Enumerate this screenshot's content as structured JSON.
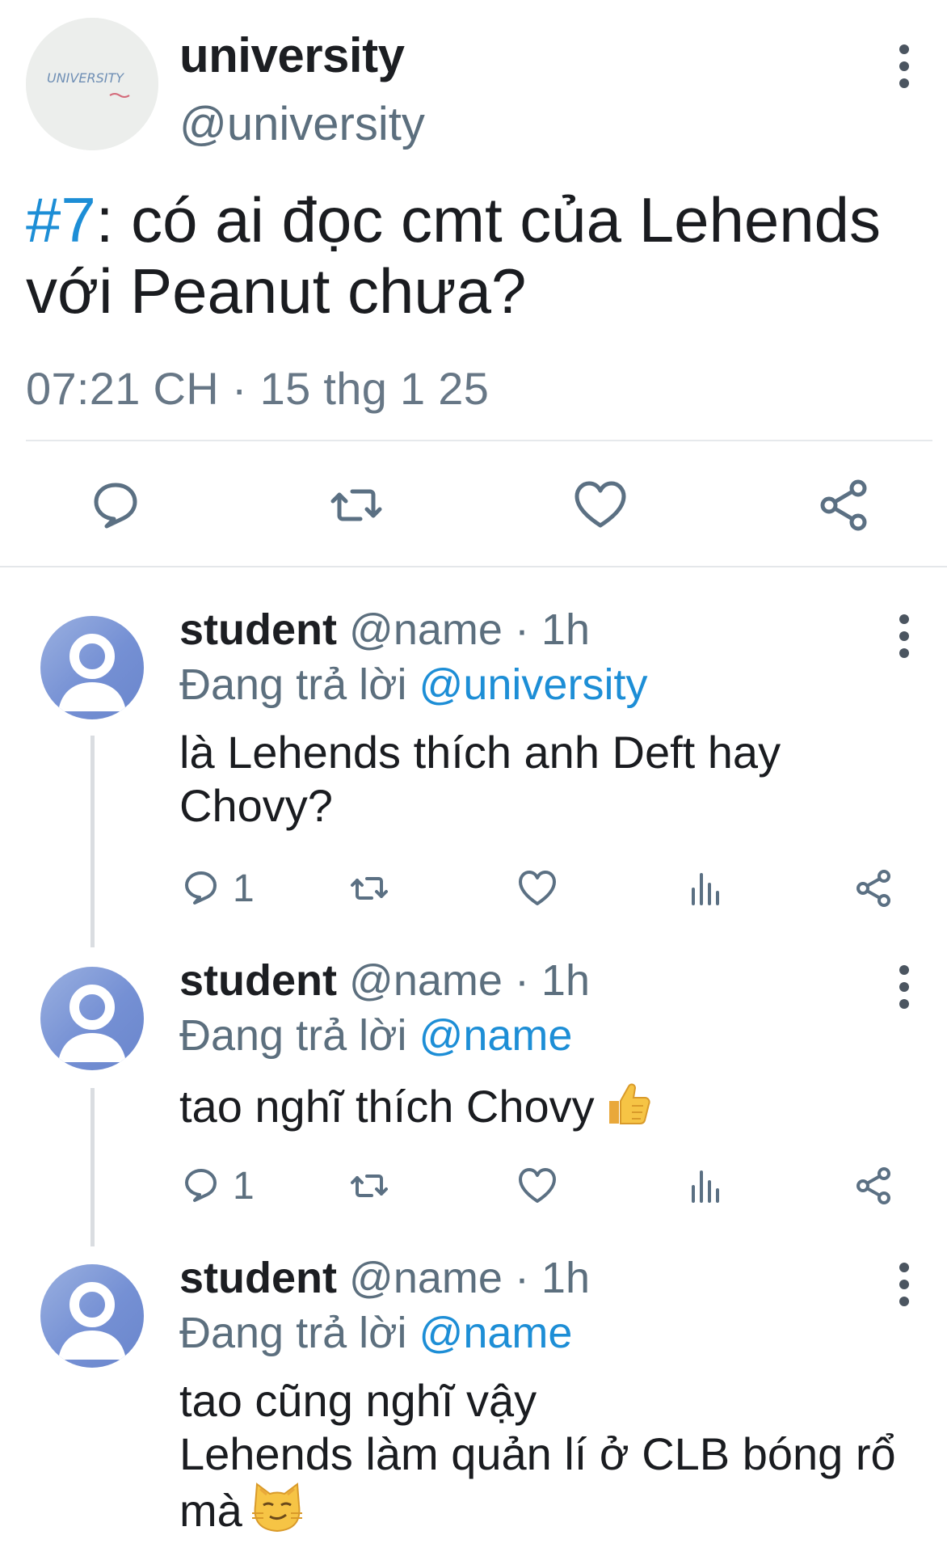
{
  "tweet": {
    "avatar_text": "UNIVERSITY",
    "name": "university",
    "handle": "@university",
    "hashtag": "#7",
    "text": ": có ai đọc cmt của Lehends với Peanut chưa?",
    "timestamp": "07:21 CH · 15 thg 1 25",
    "actions": [
      "reply-icon",
      "retweet-icon",
      "like-icon",
      "share-icon"
    ]
  },
  "replies": [
    {
      "name": "student",
      "handle": "@name",
      "time": "· 1h",
      "replying_prefix": "Đang trả lời",
      "replying_to": "@university",
      "text_lines": [
        "là Lehends thích anh Deft hay",
        "Chovy?"
      ],
      "reply_count": "1"
    },
    {
      "name": "student",
      "handle": "@name",
      "time": "· 1h",
      "replying_prefix": "Đang trả lời",
      "replying_to": "@name",
      "text_lines": [
        "tao nghĩ thích Chovy"
      ],
      "emoji": "thumbs-up",
      "reply_count": "1"
    },
    {
      "name": "student",
      "handle": "@name",
      "time": "· 1h",
      "replying_prefix": "Đang trả lời",
      "replying_to": "@name",
      "text_lines": [
        "tao cũng nghĩ vậy",
        "Lehends làm quản lí ở CLB bóng rổ",
        "mà"
      ],
      "emoji": "smirking-cat"
    }
  ],
  "colors": {
    "link": "#1d8ed6",
    "secondary_text": "#5c6f7e",
    "icon": "#5b7083",
    "divider": "#e6e9ec"
  }
}
